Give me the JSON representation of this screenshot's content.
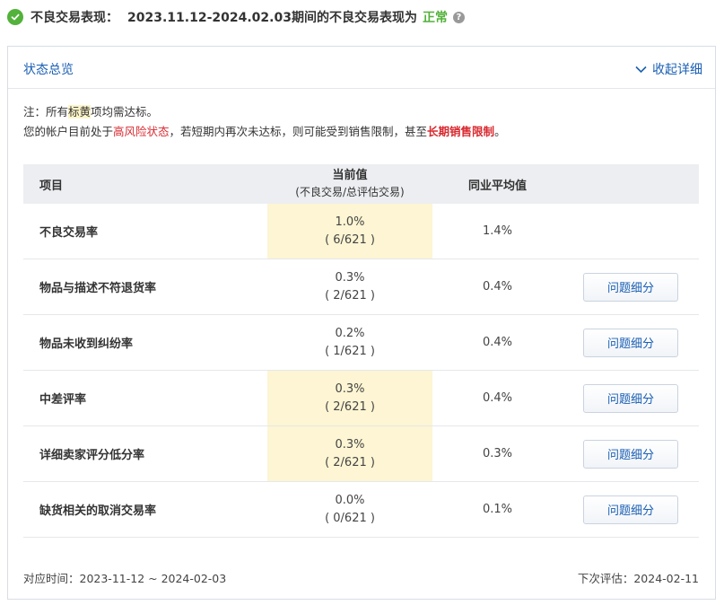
{
  "header": {
    "label": "不良交易表现：",
    "period_text": "2023.11.12-2024.02.03期间的不良交易表现为",
    "status": "正常"
  },
  "panel": {
    "title": "状态总览",
    "collapse_label": "收起详细"
  },
  "notes": {
    "line1_prefix": "注：所有",
    "line1_highlight": "标黄",
    "line1_suffix": "项均需达标。",
    "line2_prefix": "您的帐户目前处于",
    "line2_risk": "高风险状态",
    "line2_middle": "，若短期内再次未达标，则可能受到销售限制，甚至",
    "line2_limit": "长期销售限制",
    "line2_suffix": "。"
  },
  "table": {
    "headers": {
      "item": "项目",
      "current": "当前值",
      "current_sub": "(不良交易/总评估交易)",
      "average": "同业平均值"
    },
    "rows": [
      {
        "name": "不良交易率",
        "value": "1.0%",
        "ratio": "( 6/621 )",
        "avg": "1.4%",
        "highlighted": true,
        "button": ""
      },
      {
        "name": "物品与描述不符退货率",
        "value": "0.3%",
        "ratio": "( 2/621 )",
        "avg": "0.4%",
        "highlighted": false,
        "button": "问题细分"
      },
      {
        "name": "物品未收到纠纷率",
        "value": "0.2%",
        "ratio": "( 1/621 )",
        "avg": "0.4%",
        "highlighted": false,
        "button": "问题细分"
      },
      {
        "name": "中差评率",
        "value": "0.3%",
        "ratio": "( 2/621 )",
        "avg": "0.4%",
        "highlighted": true,
        "button": "问题细分"
      },
      {
        "name": "详细卖家评分低分率",
        "value": "0.3%",
        "ratio": "( 2/621 )",
        "avg": "0.3%",
        "highlighted": true,
        "button": "问题细分"
      },
      {
        "name": "缺货相关的取消交易率",
        "value": "0.0%",
        "ratio": "( 0/621 )",
        "avg": "0.1%",
        "highlighted": false,
        "button": "问题细分"
      }
    ]
  },
  "footer": {
    "period": "对应时间：2023-11-12 ~ 2024-02-03",
    "next_eval": "下次评估：2024-02-11"
  },
  "colors": {
    "status_green": "#52b23a",
    "link_blue": "#1a5fb4",
    "warning_red": "#d8292f",
    "highlight_yellow": "#fdf5d3"
  }
}
